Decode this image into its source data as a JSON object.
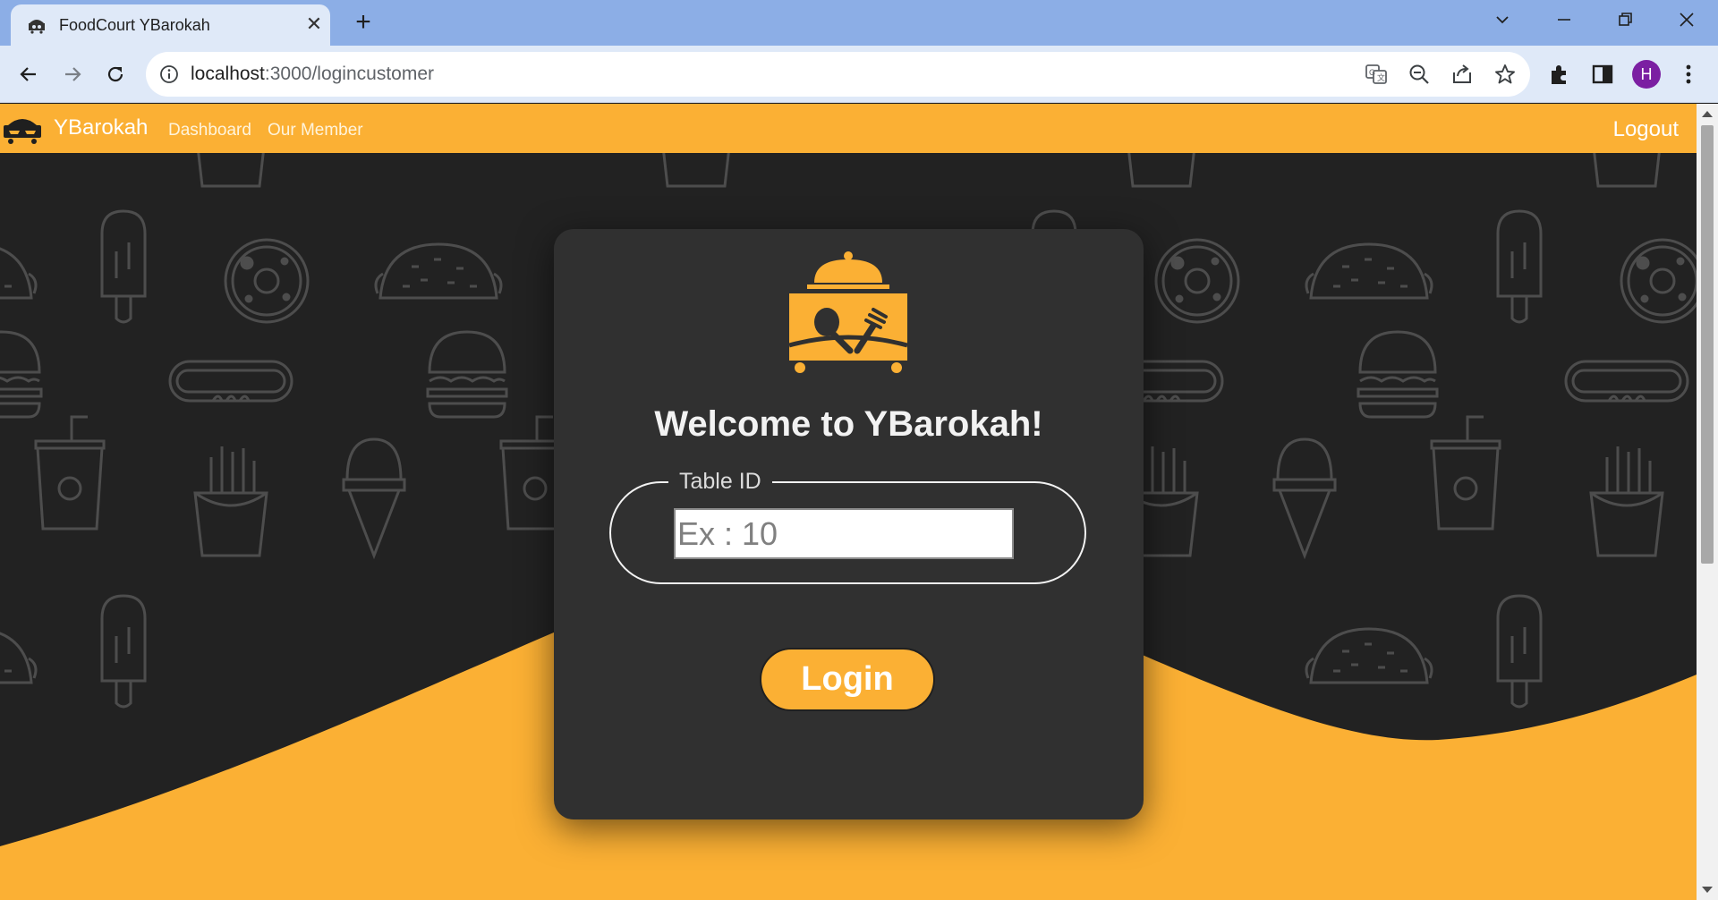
{
  "browser": {
    "tab_title": "FoodCourt YBarokah",
    "tab_close": "✕",
    "new_tab": "+",
    "url_host": "localhost",
    "url_path": ":3000/logincustomer",
    "profile_initial": "H"
  },
  "navbar": {
    "brand": "YBarokah",
    "links": [
      "Dashboard",
      "Our Member"
    ],
    "logout": "Logout"
  },
  "login": {
    "welcome": "Welcome to YBarokah!",
    "field_legend": "Table ID",
    "field_placeholder": "Ex : 10",
    "button": "Login"
  },
  "colors": {
    "accent": "#fbb034",
    "background": "#222222",
    "card": "#303030",
    "pattern": "#4d4d4d"
  },
  "icons": {
    "pattern": [
      "fries-icon",
      "popsicle-icon",
      "donut-icon",
      "taco-icon",
      "burger-icon",
      "hotdog-icon",
      "soda-cup-icon",
      "ice-cream-cone-icon"
    ],
    "logo": "food-cart-cloche-icon"
  }
}
